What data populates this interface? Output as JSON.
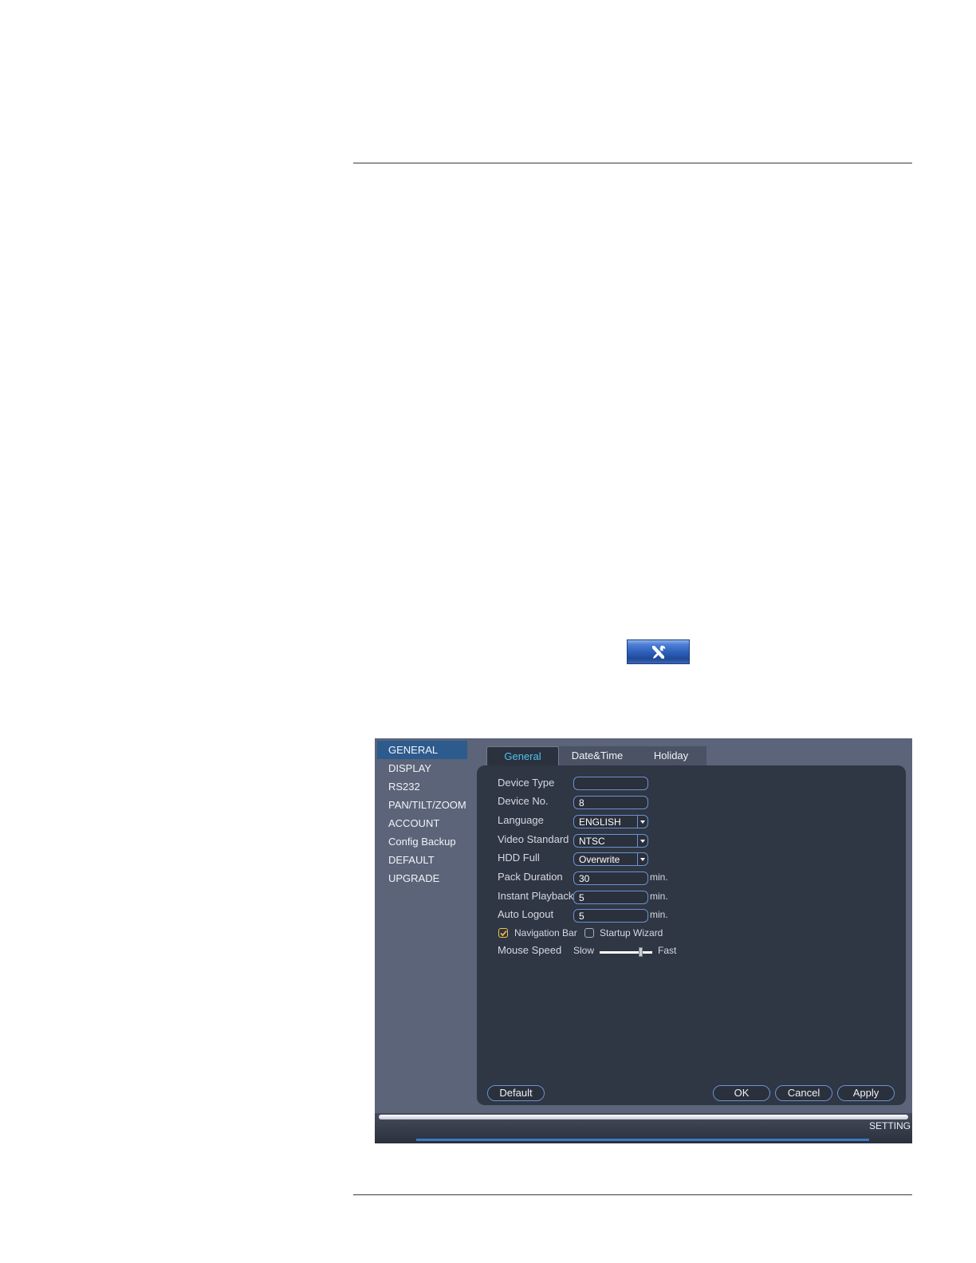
{
  "setting_icon": "tools-icon",
  "window": {
    "sidebar": [
      "GENERAL",
      "DISPLAY",
      "RS232",
      "PAN/TILT/ZOOM",
      "ACCOUNT",
      "Config Backup",
      "DEFAULT",
      "UPGRADE"
    ],
    "sidebar_active": "GENERAL",
    "tabs": [
      "General",
      "Date&Time",
      "Holiday"
    ],
    "active_tab": "General",
    "fields": {
      "device_type": {
        "label": "Device Type",
        "value": ""
      },
      "device_no": {
        "label": "Device No.",
        "value": "8"
      },
      "language": {
        "label": "Language",
        "value": "ENGLISH"
      },
      "video_standard": {
        "label": "Video Standard",
        "value": "NTSC"
      },
      "hdd_full": {
        "label": "HDD Full",
        "value": "Overwrite"
      },
      "pack_duration": {
        "label": "Pack Duration",
        "value": "30",
        "unit": "min."
      },
      "instant_playback": {
        "label": "Instant Playback",
        "value": "5",
        "unit": "min."
      },
      "auto_logout": {
        "label": "Auto Logout",
        "value": "5",
        "unit": "min."
      }
    },
    "checkboxes": {
      "navigation_bar": {
        "label": "Navigation Bar",
        "checked": true
      },
      "startup_wizard": {
        "label": "Startup Wizard",
        "checked": false
      }
    },
    "mouse_speed": {
      "label": "Mouse Speed",
      "slow": "Slow",
      "fast": "Fast",
      "level": 0.78
    },
    "buttons": {
      "default": "Default",
      "ok": "OK",
      "cancel": "Cancel",
      "apply": "Apply"
    },
    "status_text": "SETTING",
    "colors": {
      "active_tab": "#4fc3f2",
      "accent": "#2e5b8e",
      "checkbox_checked": "#f1c24b"
    }
  }
}
